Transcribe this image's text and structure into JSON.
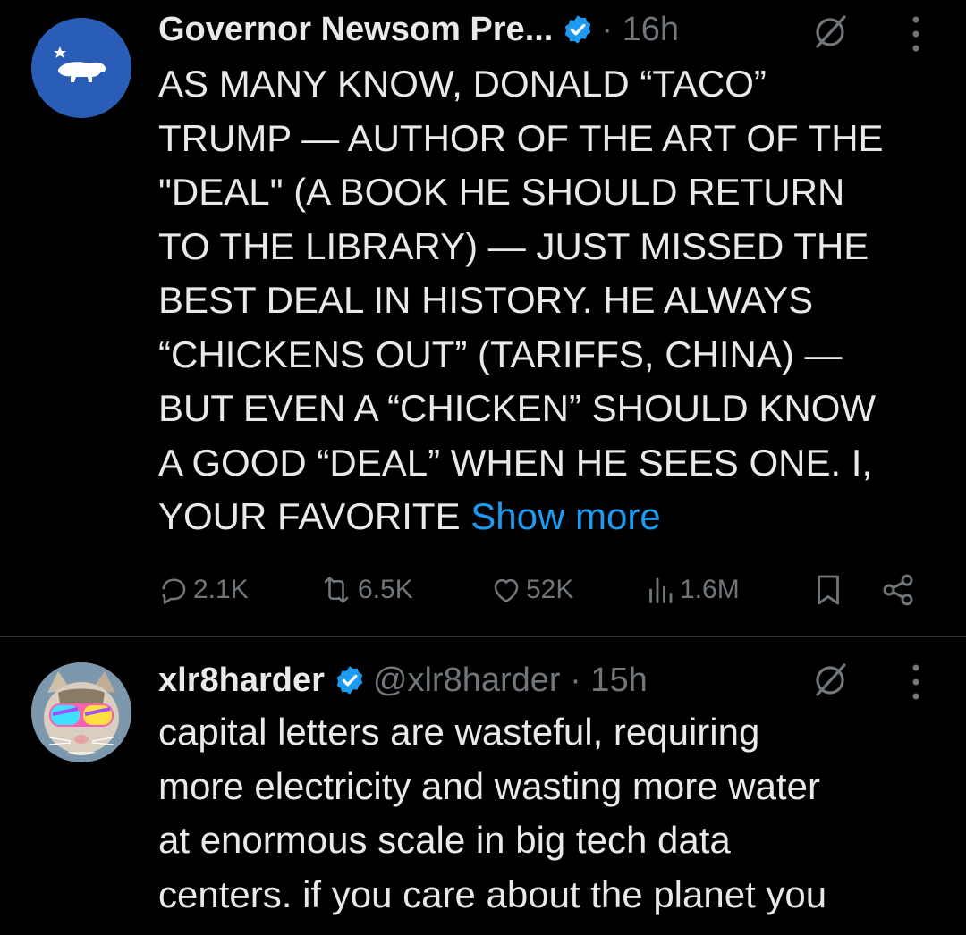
{
  "tweets": [
    {
      "author": "Governor Newsom Pre...",
      "verified": true,
      "time": "· 16h",
      "avatar_icon": "california-bear-icon",
      "lines": [
        "AS MANY KNOW, DONALD “TACO”",
        "TRUMP — AUTHOR OF THE ART OF THE",
        "\"DEAL\" (A BOOK HE SHOULD RETURN",
        "TO THE LIBRARY) — JUST MISSED THE",
        "BEST DEAL IN HISTORY. HE ALWAYS",
        "“CHICKENS OUT” (TARIFFS, CHINA) —",
        "BUT EVEN A “CHICKEN” SHOULD KNOW",
        "A GOOD “DEAL” WHEN HE SEES ONE. I,",
        "YOUR FAVORITE"
      ],
      "show_more": "Show more",
      "stats": {
        "replies": "2.1K",
        "reposts": "6.5K",
        "likes": "52K",
        "views": "1.6M"
      }
    },
    {
      "author": "xlr8harder",
      "verified": true,
      "handle_time": "@xlr8harder · 15h",
      "avatar_icon": "cat-with-goggles-avatar",
      "lines": [
        "capital letters are wasteful, requiring",
        "more electricity and wasting more water",
        "at enormous scale in big tech data",
        "centers. if you care about the planet you"
      ]
    }
  ],
  "colors": {
    "background": "#000000",
    "text": "#e7e9ea",
    "muted": "#71767b",
    "link": "#1d9bf0",
    "divider": "#2f3336",
    "verified": "#1d9bf0"
  }
}
